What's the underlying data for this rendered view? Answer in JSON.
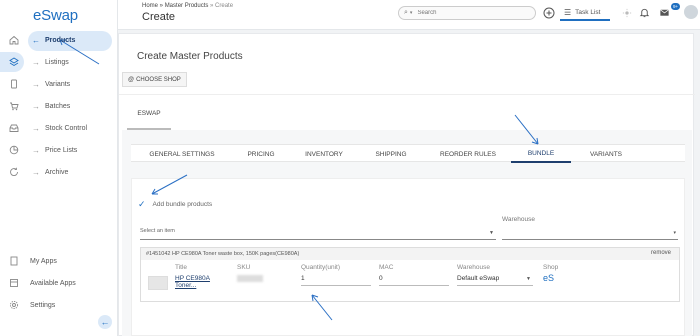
{
  "app": {
    "logo": "eSwap"
  },
  "sidebar": {
    "items": [
      {
        "label": "Products",
        "icon": "home-icon",
        "active": true
      },
      {
        "label": "Listings",
        "icon": "layers-icon"
      },
      {
        "label": "Variants",
        "icon": "tablet-icon"
      },
      {
        "label": "Batches",
        "icon": "cart-icon"
      },
      {
        "label": "Stock Control",
        "icon": "inbox-icon"
      },
      {
        "label": "Price Lists",
        "icon": "pie-icon"
      },
      {
        "label": "Archive",
        "icon": "refresh-icon"
      }
    ],
    "bottom": [
      {
        "label": "My Apps",
        "icon": "apps-icon"
      },
      {
        "label": "Available Apps",
        "icon": "store-icon"
      },
      {
        "label": "Settings",
        "icon": "gear-icon"
      }
    ]
  },
  "header": {
    "breadcrumb_home": "Home",
    "breadcrumb_sep1": " » ",
    "breadcrumb_section": "Master Products",
    "breadcrumb_sep2": " » ",
    "breadcrumb_current": "Create",
    "title": "Create",
    "search_placeholder": "Search",
    "task_list": "Task List",
    "notification_badge": "9+"
  },
  "card": {
    "title": "Create Master Products",
    "choose_shop": "CHOOSE SHOP",
    "shop_tab": "ESWAP"
  },
  "tabs": [
    {
      "label": "GENERAL SETTINGS"
    },
    {
      "label": "PRICING"
    },
    {
      "label": "INVENTORY"
    },
    {
      "label": "SHIPPING"
    },
    {
      "label": "REORDER RULES"
    },
    {
      "label": "BUNDLE",
      "active": true
    },
    {
      "label": "VARIANTS"
    }
  ],
  "bundle": {
    "checkbox_label": "Add bundle products",
    "warehouse_label": "Warehouse",
    "item_placeholder": "Select an item",
    "product_heading": "#1451042 HP CE980A Toner waste box, 150K pages(CE980A)",
    "remove": "remove",
    "columns": {
      "title_h": "Title",
      "title_v": "HP CE980A Toner...",
      "sku_h": "SKU",
      "qty_h": "Quantity(unit)",
      "qty_v": "1",
      "mac_h": "MAC",
      "mac_v": "0",
      "wh_h": "Warehouse",
      "wh_v": "Default eSwap",
      "shop_h": "Shop",
      "shop_v": "eS"
    }
  },
  "colors": {
    "accent": "#1f6fc0",
    "annotation": "#2a6fc4"
  }
}
